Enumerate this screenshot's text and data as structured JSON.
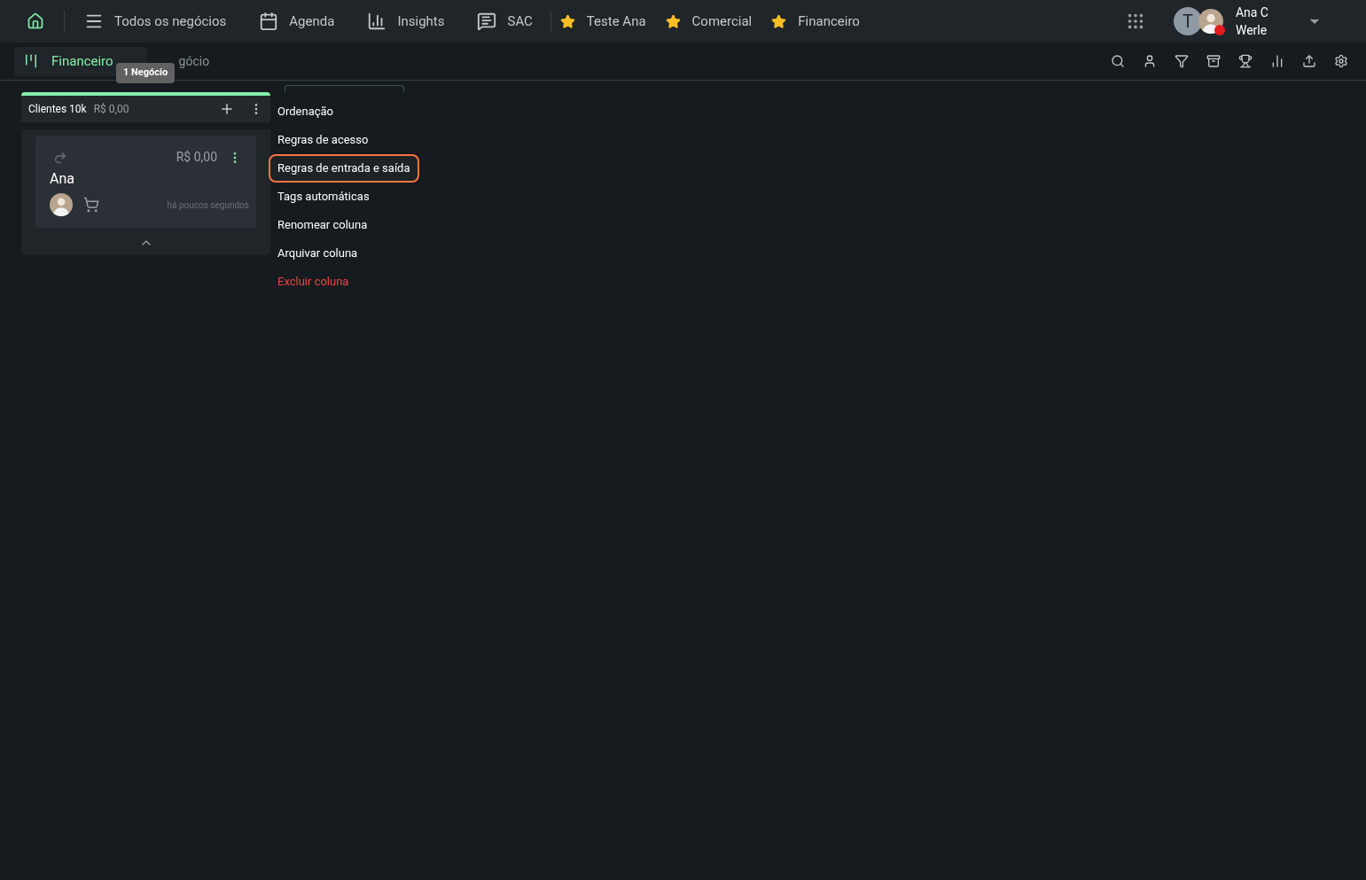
{
  "nav": {
    "items": [
      "Todos os negócios",
      "Agenda",
      "Insights",
      "SAC"
    ],
    "favorites": [
      "Teste Ana",
      "Comercial",
      "Financeiro"
    ],
    "user": {
      "initial": "T",
      "name_line1": "Ana C",
      "name_line2": "Werle"
    }
  },
  "board": {
    "tab": {
      "label": "Financeiro",
      "selected": true
    },
    "subtitle": "gócio",
    "tooltip": "1 Negócio"
  },
  "column": {
    "title": "Clientes 10k",
    "total": "R$ 0,00",
    "card": {
      "value": "R$ 0,00",
      "name": "Ana",
      "time": "há poucos segundos"
    }
  },
  "menu": [
    {
      "label": "Ordenação",
      "kind": "normal",
      "highlighted": false
    },
    {
      "label": "Regras de acesso",
      "kind": "normal",
      "highlighted": false
    },
    {
      "label": "Regras de entrada e saída",
      "kind": "normal",
      "highlighted": true
    },
    {
      "label": "Tags automáticas",
      "kind": "normal",
      "highlighted": false
    },
    {
      "label": "Renomear coluna",
      "kind": "normal",
      "highlighted": false
    },
    {
      "label": "Arquivar coluna",
      "kind": "normal",
      "highlighted": false
    },
    {
      "label": "Excluir coluna",
      "kind": "danger",
      "highlighted": false
    }
  ]
}
